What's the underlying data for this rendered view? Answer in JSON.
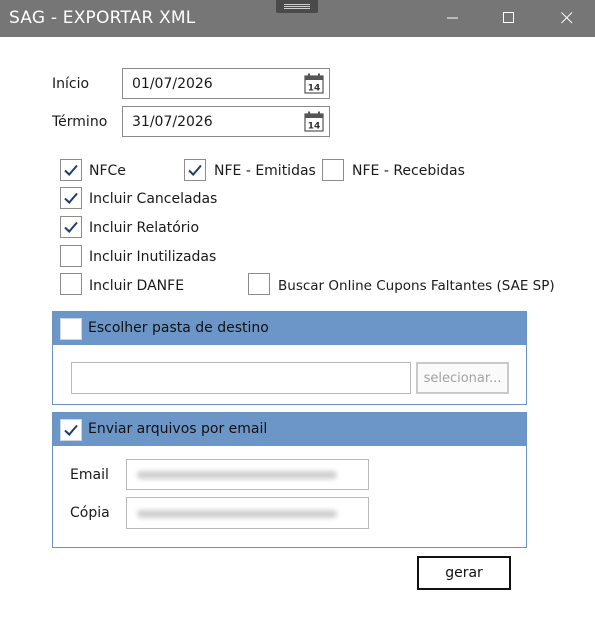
{
  "window": {
    "title": "SAG - EXPORTAR XML"
  },
  "icons": {
    "minimize": "minimize-icon",
    "maximize": "maximize-icon",
    "close": "close-icon",
    "calendar": "calendar-icon",
    "checkmark": "check-icon"
  },
  "dates": {
    "inicio_label": "Início",
    "inicio_value": "01/07/2026",
    "termino_label": "Término",
    "termino_value": "31/07/2026",
    "calendar_day": "14"
  },
  "options": {
    "nfce": {
      "label": "NFCe",
      "checked": true
    },
    "nfe_emitidas": {
      "label": "NFE - Emitidas",
      "checked": true
    },
    "nfe_recebidas": {
      "label": "NFE - Recebidas",
      "checked": false
    },
    "incluir_canceladas": {
      "label": "Incluir Canceladas",
      "checked": true
    },
    "incluir_relatorio": {
      "label": "Incluir Relatório",
      "checked": true
    },
    "incluir_inutilizadas": {
      "label": "Incluir Inutilizadas",
      "checked": false
    },
    "incluir_danfe": {
      "label": "Incluir DANFE",
      "checked": false
    },
    "buscar_online": {
      "label": "Buscar Online Cupons Faltantes (SAE SP)",
      "checked": false
    }
  },
  "pasta": {
    "title": "Escolher pasta de destino",
    "checked": false,
    "path_value": "",
    "button_label": "selecionar..."
  },
  "email": {
    "title": "Enviar arquivos por email",
    "checked": true,
    "email_label": "Email",
    "copia_label": "Cópia"
  },
  "actions": {
    "gerar_label": "gerar"
  },
  "colors": {
    "titlebar": "#767676",
    "group_header": "#6c96c7",
    "group_border": "#6a93c3",
    "checkmark": "#1f3f66"
  }
}
